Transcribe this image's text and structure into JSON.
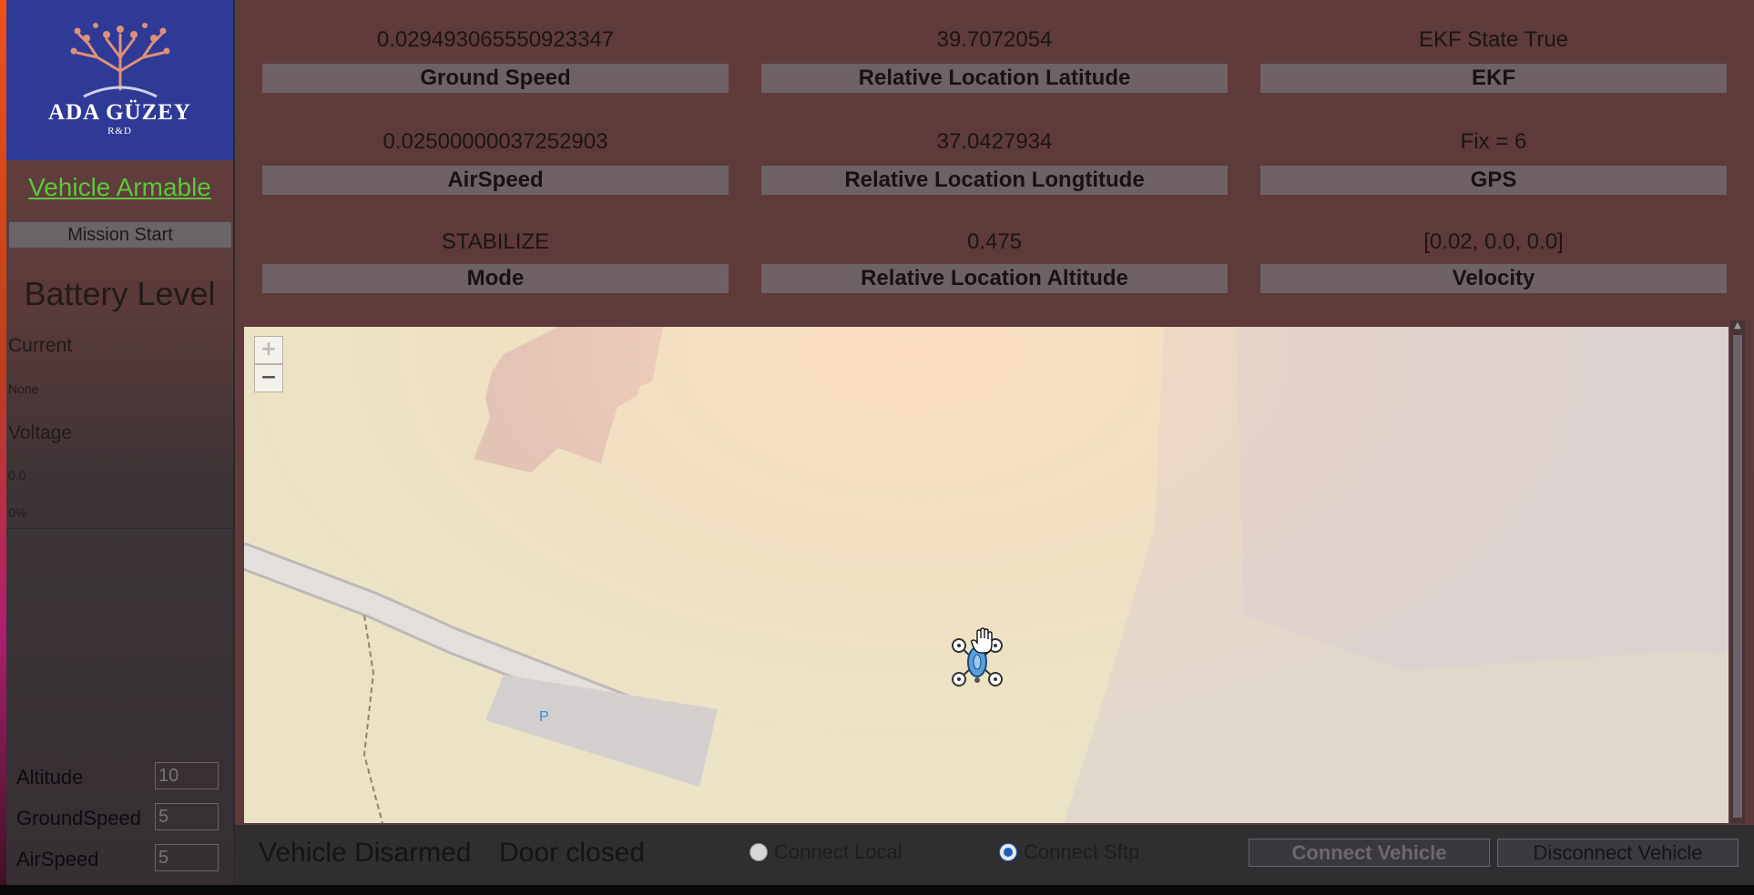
{
  "sidebar": {
    "logo": {
      "title": "ADA GÜZEY",
      "subtitle": "R&D"
    },
    "armable_label": "Vehicle Armable",
    "mission_button": "Mission Start",
    "battery_title": "Battery Level",
    "current_label": "Current",
    "current_value": "None",
    "voltage_label": "Voltage",
    "voltage_value": "0.0",
    "battery_percent": "0%",
    "params": [
      {
        "label": "Altitude",
        "placeholder": "10"
      },
      {
        "label": "GroundSpeed",
        "placeholder": "5"
      },
      {
        "label": "AirSpeed",
        "placeholder": "5"
      }
    ]
  },
  "telemetry": [
    {
      "value": "0.029493065550923347",
      "label": "Ground Speed"
    },
    {
      "value": "39.7072054",
      "label": "Relative Location Latitude"
    },
    {
      "value": "EKF State True",
      "label": "EKF"
    },
    {
      "value": "0.02500000037252903",
      "label": "AirSpeed"
    },
    {
      "value": "37.0427934",
      "label": "Relative Location Longtitude"
    },
    {
      "value": "Fix = 6",
      "label": "GPS"
    },
    {
      "value": "STABILIZE",
      "label": "Mode"
    },
    {
      "value": "0.475",
      "label": "Relative Location Altitude"
    },
    {
      "value": "[0.02, 0.0, 0.0]",
      "label": "Velocity"
    }
  ],
  "map": {
    "zoom_in": "+",
    "zoom_out": "−",
    "parking_label": "P"
  },
  "status": {
    "armed_text": "Vehicle Disarmed",
    "door_text": "Door closed"
  },
  "connection": {
    "local_label": "Connect Local",
    "sftp_label": "Connect Sftp",
    "selected": "Connect Sftp",
    "connect_button": "Connect Vehicle",
    "disconnect_button": "Disconnect Vehicle"
  },
  "colors": {
    "armable_green": "#5ac83a",
    "logo_blue": "#2e3a95",
    "radio_selected": "#1d5fb8"
  }
}
